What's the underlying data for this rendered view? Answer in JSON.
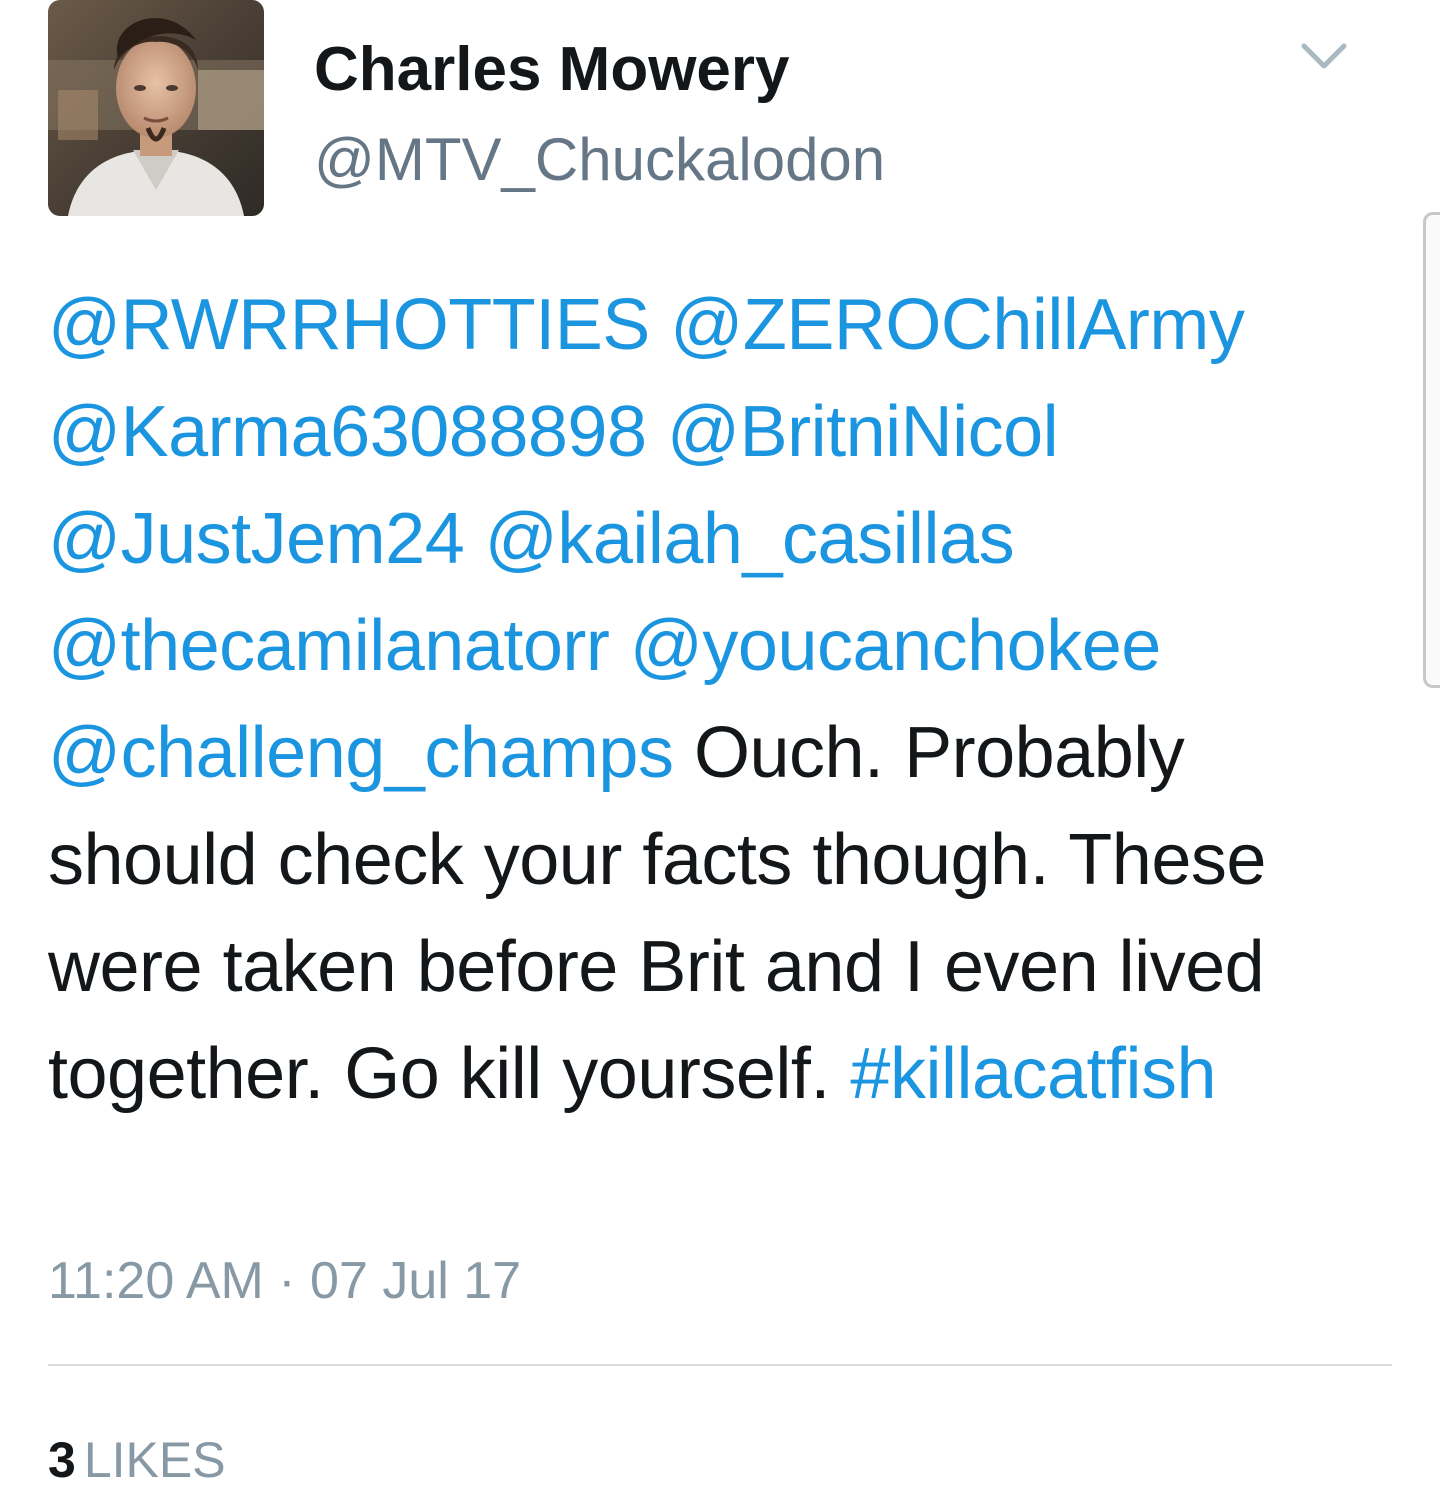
{
  "author": {
    "name": "Charles Mowery",
    "handle": "@MTV_Chuckalodon"
  },
  "tweet": {
    "mentions": [
      "@RWRRHOTTIES",
      "@ZEROChillArmy",
      "@Karma63088898",
      "@BritniNicol",
      "@JustJem24",
      "@kailah_casillas",
      "@thecamilanatorr",
      "@youcanchokee",
      "@challeng_champs"
    ],
    "text": "Ouch. Probably should check your facts though. These were taken before Brit and I even lived together. Go kill yourself.",
    "hashtag": "#killacatfish"
  },
  "timestamp": "11:20 AM · 07 Jul 17",
  "stats": {
    "likes_count": "3",
    "likes_label": "LIKES"
  },
  "icons": {
    "menu": "chevron-down-icon",
    "avatar": "profile-photo"
  },
  "colors": {
    "link": "#1b95e0",
    "text": "#14171a",
    "secondary": "#657786",
    "muted": "#8899a6",
    "divider": "#d8dde1"
  }
}
